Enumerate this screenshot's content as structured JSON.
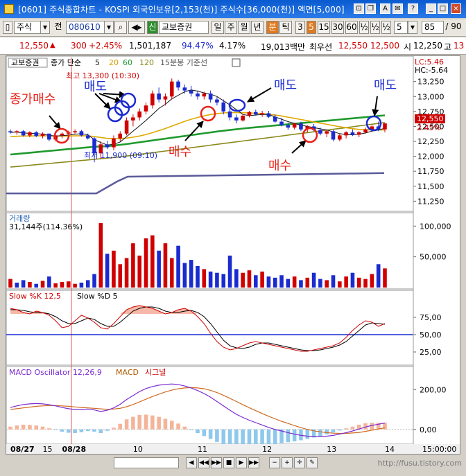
{
  "window": {
    "title": "[0601] 주식종합차트 - KOSPI 외국인보유[2,153(천)] 주식수[36,000(천)] 액면[5,000]",
    "buttons": [
      "A",
      "?",
      "_",
      "□",
      "×"
    ]
  },
  "toolbar": {
    "market_type": "주식",
    "prefix_label": "전",
    "stock_code": "080610",
    "stock_badge": "신",
    "stock_name": "교보증권",
    "period_tabs": [
      "일",
      "주",
      "월",
      "년",
      "분",
      "틱"
    ],
    "active_period": "분",
    "intervals": [
      "3",
      "5",
      "15",
      "30",
      "60",
      "½",
      "½",
      "½"
    ],
    "active_interval": "5",
    "interval_select": "5",
    "count_value": "85",
    "count_total": "/ 90"
  },
  "quote": {
    "price": "12,550",
    "change_arrow": "▲",
    "change": "300",
    "change_pct": "+2.45%",
    "volume": "1,501,187",
    "volume_ratio": "94.47%",
    "turnover": "4.17%",
    "amount": "19,013백만",
    "best_ask_label": "최우선",
    "best_ask": "12,550",
    "best_bid": "12,500",
    "open_label": "시",
    "open": "12,250",
    "high_label": "고",
    "high": "13"
  },
  "colors": {
    "up": "#d00000",
    "down": "#1a2bd0",
    "ma5": "#111111",
    "ma20": "#e0a800",
    "ma60": "#1f9a2e",
    "ma120": "#8a8a1c",
    "reference_line": "#5a5a9a",
    "annotation": "#e8221a",
    "annotation_blue": "#1a2bd0"
  },
  "price_panel": {
    "stock_name": "교보증권",
    "legend_prefix": "종가 단순",
    "ma_periods": [
      "5",
      "20",
      "60",
      "120"
    ],
    "period_label": "15분봉 기준선",
    "lc_label": "LC:5.46",
    "hc_label": "HC:-5.64",
    "current_price": "12,550",
    "current_pct": "2.45%",
    "high_mark": "최고 13,300 (10:30)",
    "low_mark": "최저 11,900 (09:10)",
    "y_ticks": [
      "13,250",
      "13,000",
      "12,750",
      "12,500",
      "12,250",
      "12,000",
      "11,750",
      "11,500",
      "11,250"
    ],
    "annotations": [
      {
        "text": "종가매수",
        "color": "red"
      },
      {
        "text": "매도",
        "color": "blue"
      },
      {
        "text": "매수",
        "color": "red"
      },
      {
        "text": "매도",
        "color": "blue"
      },
      {
        "text": "매수",
        "color": "red"
      },
      {
        "text": "매도",
        "color": "blue"
      }
    ]
  },
  "volume_panel": {
    "title": "거래량",
    "reading": "31,144주(114.36%)",
    "y_ticks": [
      "100,000",
      "50,000"
    ]
  },
  "stoch_panel": {
    "title_k": "Slow %K 12,5",
    "title_d": "Slow %D 5",
    "y_ticks": [
      "75,00",
      "50,00",
      "25,00"
    ]
  },
  "macd_panel": {
    "title_osc": "MACD Oscillator 12,26,9",
    "title_macd": "MACD",
    "title_signal": "시그널",
    "y_ticks": [
      "200,00",
      "0,00"
    ]
  },
  "x_axis": {
    "labels": [
      "08/27",
      "15",
      "08/28",
      "10",
      "11",
      "12",
      "13",
      "14"
    ],
    "right_label": "15:00:00"
  },
  "footer": {
    "watermark": "http://fusu.tistory.com"
  },
  "chart_data": {
    "type": "candlestick",
    "timeframe": "5분봉",
    "ylim": [
      11150,
      13420
    ],
    "candles": [
      {
        "o": 12420,
        "h": 12450,
        "l": 12380,
        "c": 12400
      },
      {
        "o": 12400,
        "h": 12440,
        "l": 12360,
        "c": 12420
      },
      {
        "o": 12420,
        "h": 12440,
        "l": 12330,
        "c": 12350
      },
      {
        "o": 12350,
        "h": 12420,
        "l": 12320,
        "c": 12400
      },
      {
        "o": 12400,
        "h": 12420,
        "l": 12320,
        "c": 12340
      },
      {
        "o": 12340,
        "h": 12400,
        "l": 12300,
        "c": 12380
      },
      {
        "o": 12380,
        "h": 12380,
        "l": 12250,
        "c": 12280
      },
      {
        "o": 12280,
        "h": 12360,
        "l": 12250,
        "c": 12350
      },
      {
        "o": 12350,
        "h": 12400,
        "l": 12300,
        "c": 12380
      },
      {
        "o": 12380,
        "h": 12430,
        "l": 12350,
        "c": 12400
      },
      {
        "o": 12400,
        "h": 12450,
        "l": 12380,
        "c": 12420
      },
      {
        "o": 12420,
        "h": 12440,
        "l": 12330,
        "c": 12350
      },
      {
        "o": 12350,
        "h": 12380,
        "l": 12280,
        "c": 12300
      },
      {
        "o": 12300,
        "h": 12320,
        "l": 11900,
        "c": 12050
      },
      {
        "o": 12050,
        "h": 12250,
        "l": 11950,
        "c": 12200
      },
      {
        "o": 12200,
        "h": 12260,
        "l": 12120,
        "c": 12150
      },
      {
        "o": 12150,
        "h": 12350,
        "l": 12100,
        "c": 12300
      },
      {
        "o": 12300,
        "h": 12420,
        "l": 12250,
        "c": 12380
      },
      {
        "o": 12380,
        "h": 12650,
        "l": 12350,
        "c": 12600
      },
      {
        "o": 12600,
        "h": 12700,
        "l": 12500,
        "c": 12650
      },
      {
        "o": 12650,
        "h": 12800,
        "l": 12600,
        "c": 12750
      },
      {
        "o": 12750,
        "h": 12900,
        "l": 12700,
        "c": 12850
      },
      {
        "o": 12850,
        "h": 13100,
        "l": 12800,
        "c": 13050
      },
      {
        "o": 13050,
        "h": 13150,
        "l": 12900,
        "c": 12950
      },
      {
        "o": 12950,
        "h": 13050,
        "l": 12850,
        "c": 13000
      },
      {
        "o": 13000,
        "h": 13300,
        "l": 12950,
        "c": 13250
      },
      {
        "o": 13250,
        "h": 13280,
        "l": 13100,
        "c": 13150
      },
      {
        "o": 13150,
        "h": 13200,
        "l": 13050,
        "c": 13100
      },
      {
        "o": 13100,
        "h": 13180,
        "l": 13000,
        "c": 13050
      },
      {
        "o": 13050,
        "h": 13100,
        "l": 12950,
        "c": 13000
      },
      {
        "o": 13000,
        "h": 13080,
        "l": 12950,
        "c": 13050
      },
      {
        "o": 13050,
        "h": 13100,
        "l": 12900,
        "c": 12950
      },
      {
        "o": 12950,
        "h": 12990,
        "l": 12850,
        "c": 12900
      },
      {
        "o": 12900,
        "h": 12950,
        "l": 12700,
        "c": 12750
      },
      {
        "o": 12750,
        "h": 12800,
        "l": 12600,
        "c": 12650
      },
      {
        "o": 12650,
        "h": 12700,
        "l": 12550,
        "c": 12600
      },
      {
        "o": 12600,
        "h": 12700,
        "l": 12580,
        "c": 12680
      },
      {
        "o": 12680,
        "h": 12760,
        "l": 12650,
        "c": 12740
      },
      {
        "o": 12740,
        "h": 12780,
        "l": 12680,
        "c": 12700
      },
      {
        "o": 12700,
        "h": 12760,
        "l": 12660,
        "c": 12720
      },
      {
        "o": 12720,
        "h": 12760,
        "l": 12640,
        "c": 12660
      },
      {
        "o": 12660,
        "h": 12700,
        "l": 12560,
        "c": 12580
      },
      {
        "o": 12580,
        "h": 12640,
        "l": 12500,
        "c": 12520
      },
      {
        "o": 12520,
        "h": 12560,
        "l": 12440,
        "c": 12480
      },
      {
        "o": 12480,
        "h": 12560,
        "l": 12450,
        "c": 12550
      },
      {
        "o": 12550,
        "h": 12580,
        "l": 12420,
        "c": 12450
      },
      {
        "o": 12450,
        "h": 12520,
        "l": 12400,
        "c": 12500
      },
      {
        "o": 12500,
        "h": 12540,
        "l": 12420,
        "c": 12440
      },
      {
        "o": 12440,
        "h": 12480,
        "l": 12350,
        "c": 12380
      },
      {
        "o": 12380,
        "h": 12450,
        "l": 12320,
        "c": 12420
      },
      {
        "o": 12420,
        "h": 12440,
        "l": 12250,
        "c": 12280
      },
      {
        "o": 12280,
        "h": 12380,
        "l": 12250,
        "c": 12350
      },
      {
        "o": 12350,
        "h": 12420,
        "l": 12300,
        "c": 12400
      },
      {
        "o": 12400,
        "h": 12450,
        "l": 12340,
        "c": 12360
      },
      {
        "o": 12360,
        "h": 12420,
        "l": 12320,
        "c": 12400
      },
      {
        "o": 12400,
        "h": 12480,
        "l": 12380,
        "c": 12450
      },
      {
        "o": 12450,
        "h": 12520,
        "l": 12420,
        "c": 12500
      },
      {
        "o": 12500,
        "h": 12580,
        "l": 12420,
        "c": 12450
      },
      {
        "o": 12450,
        "h": 12550,
        "l": 12400,
        "c": 12550
      }
    ],
    "ma5": [
      12400,
      12405,
      12390,
      12385,
      12380,
      12370,
      12350,
      12340,
      12345,
      12355,
      12370,
      12380,
      12360,
      12280,
      12230,
      12190,
      12200,
      12240,
      12330,
      12420,
      12510,
      12600,
      12700,
      12800,
      12870,
      12960,
      13020,
      13080,
      13110,
      13090,
      13060,
      13040,
      13000,
      12930,
      12860,
      12780,
      12700,
      12680,
      12690,
      12700,
      12700,
      12660,
      12620,
      12580,
      12550,
      12520,
      12500,
      12480,
      12460,
      12440,
      12410,
      12380,
      12360,
      12360,
      12370,
      12390,
      12420,
      12440,
      12470
    ],
    "ma20": [
      12330,
      12335,
      12340,
      12340,
      12342,
      12344,
      12340,
      12338,
      12338,
      12340,
      12342,
      12344,
      12342,
      12330,
      12315,
      12300,
      12295,
      12295,
      12305,
      12320,
      12340,
      12365,
      12395,
      12430,
      12465,
      12505,
      12545,
      12585,
      12620,
      12650,
      12675,
      12700,
      12715,
      12725,
      12730,
      12730,
      12728,
      12725,
      12720,
      12715,
      12705,
      12690,
      12675,
      12655,
      12635,
      12615,
      12595,
      12575,
      12555,
      12535,
      12515,
      12495,
      12478,
      12462,
      12450,
      12445,
      12442,
      12440,
      12442
    ],
    "ma60": [
      12030,
      12040,
      12050,
      12060,
      12070,
      12080,
      12090,
      12100,
      12110,
      12120,
      12130,
      12140,
      12150,
      12160,
      12165,
      12170,
      12180,
      12192,
      12205,
      12220,
      12235,
      12250,
      12265,
      12280,
      12295,
      12310,
      12325,
      12340,
      12355,
      12370,
      12385,
      12400,
      12415,
      12428,
      12440,
      12452,
      12464,
      12475,
      12485,
      12495,
      12505,
      12515,
      12525,
      12535,
      12545,
      12555,
      12565,
      12575,
      12585,
      12595,
      12605,
      12615,
      12625,
      12635,
      12645,
      12655,
      12665,
      12675,
      12685
    ],
    "ma120": [
      11820,
      11830,
      11840,
      11850,
      11860,
      11870,
      11880,
      11890,
      11900,
      11910,
      11920,
      11930,
      11940,
      11950,
      11960,
      11970,
      11980,
      11992,
      12005,
      12018,
      12032,
      12046,
      12060,
      12074,
      12088,
      12102,
      12116,
      12130,
      12144,
      12158,
      12172,
      12186,
      12200,
      12214,
      12228,
      12242,
      12256,
      12270,
      12284,
      12298,
      12312,
      12326,
      12340,
      12354,
      12368,
      12382,
      12396,
      12410,
      12424,
      12438,
      12452,
      12466,
      12480,
      12494,
      12508,
      12522,
      12536,
      12550,
      12564
    ],
    "volume": [
      14000,
      8000,
      12000,
      9000,
      6000,
      11000,
      18000,
      7000,
      9000,
      10000,
      6000,
      8000,
      12000,
      22000,
      105000,
      55000,
      60000,
      38000,
      48000,
      72000,
      52000,
      80000,
      85000,
      60000,
      72000,
      48000,
      68000,
      40000,
      45000,
      35000,
      30000,
      26000,
      24000,
      22000,
      52000,
      30000,
      24000,
      28000,
      20000,
      26000,
      18000,
      16000,
      20000,
      14000,
      18000,
      12000,
      16000,
      24000,
      14000,
      12000,
      20000,
      10000,
      18000,
      24000,
      16000,
      14000,
      22000,
      38000,
      31144
    ],
    "volume_up": [
      true,
      false,
      false,
      true,
      false,
      true,
      false,
      true,
      true,
      true,
      true,
      false,
      false,
      false,
      true,
      false,
      true,
      true,
      true,
      true,
      true,
      true,
      true,
      false,
      true,
      true,
      false,
      false,
      false,
      false,
      true,
      false,
      false,
      false,
      false,
      false,
      true,
      true,
      false,
      true,
      false,
      false,
      false,
      false,
      true,
      false,
      true,
      false,
      false,
      true,
      false,
      true,
      true,
      false,
      true,
      true,
      true,
      false,
      true
    ],
    "slow_k": [
      88,
      86,
      82,
      80,
      84,
      82,
      78,
      70,
      60,
      62,
      70,
      78,
      74,
      68,
      60,
      58,
      66,
      76,
      86,
      90,
      92,
      90,
      88,
      84,
      80,
      82,
      86,
      88,
      84,
      76,
      66,
      52,
      40,
      32,
      28,
      30,
      34,
      38,
      40,
      38,
      36,
      34,
      32,
      30,
      28,
      26,
      26,
      28,
      30,
      32,
      34,
      38,
      46,
      56,
      64,
      70,
      68,
      62,
      66
    ],
    "slow_d": [
      86,
      86,
      85,
      83,
      82,
      82,
      80,
      76,
      70,
      66,
      66,
      70,
      74,
      72,
      66,
      62,
      62,
      68,
      76,
      84,
      88,
      90,
      90,
      88,
      84,
      82,
      82,
      84,
      85,
      82,
      76,
      66,
      54,
      42,
      34,
      31,
      30,
      32,
      36,
      38,
      38,
      36,
      34,
      32,
      30,
      28,
      27,
      27,
      28,
      30,
      32,
      35,
      40,
      48,
      56,
      64,
      67,
      66,
      65
    ],
    "macd": [
      110,
      118,
      125,
      128,
      130,
      128,
      124,
      118,
      110,
      104,
      100,
      100,
      102,
      98,
      90,
      96,
      108,
      126,
      150,
      170,
      190,
      205,
      215,
      222,
      226,
      228,
      225,
      218,
      208,
      195,
      180,
      162,
      140,
      118,
      96,
      76,
      60,
      46,
      34,
      22,
      10,
      0,
      -8,
      -16,
      -24,
      -30,
      -34,
      -36,
      -36,
      -34,
      -30,
      -24,
      -16,
      -8,
      2,
      12,
      20,
      26,
      32
    ],
    "signal": [
      100,
      104,
      108,
      112,
      116,
      118,
      120,
      120,
      118,
      116,
      113,
      110,
      108,
      106,
      103,
      101,
      102,
      106,
      114,
      125,
      138,
      152,
      165,
      177,
      188,
      197,
      204,
      208,
      210,
      208,
      204,
      196,
      185,
      171,
      156,
      140,
      124,
      109,
      94,
      80,
      66,
      53,
      41,
      30,
      19,
      9,
      0,
      -7,
      -12,
      -16,
      -19,
      -20,
      -20,
      -18,
      -15,
      -10,
      -4,
      2,
      8
    ],
    "x_label_index": [
      0,
      5,
      8,
      19,
      29,
      39,
      49,
      58
    ]
  }
}
